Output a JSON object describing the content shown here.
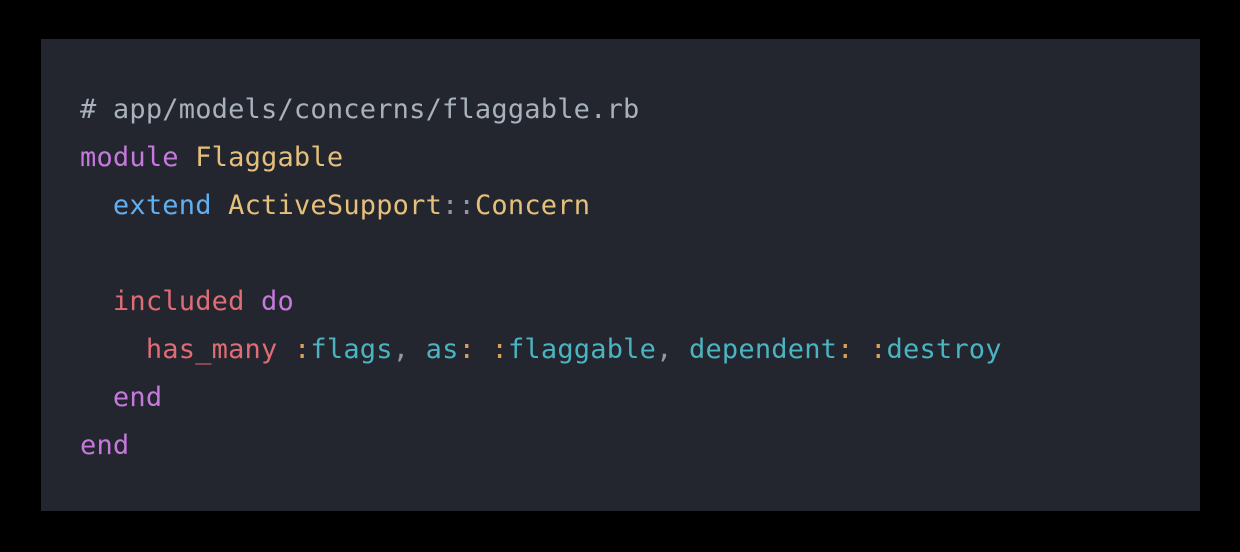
{
  "window": {
    "background_color": "#000000",
    "panel_background_color": "#23262f",
    "panel_label": "ruby-code-snippet-panel"
  },
  "theme": {
    "name": "dark",
    "comment_color": "#a9b1bd",
    "keyword_color": "#c678dd",
    "constant_color": "#e5c07b",
    "function_color": "#61afef",
    "method_color": "#e06c75",
    "symbol_color": "#4ab4c0",
    "punctuation_color": "#8f98a6",
    "colon_color": "#d9a05b",
    "plain_color": "#c5ccd6"
  },
  "code": {
    "language": "ruby",
    "file_comment": "# app/models/concerns/flaggable.rb",
    "full_text": "# app/models/concerns/flaggable.rb\nmodule Flaggable\n  extend ActiveSupport::Concern\n\n  included do\n    has_many :flags, as: :flaggable, dependent: :destroy\n  end\nend",
    "lines": [
      {
        "id": "line-1",
        "kind": "comment",
        "tokens": [
          {
            "text": "# app/models/concerns/flaggable.rb",
            "type": "comment"
          }
        ]
      },
      {
        "id": "line-2",
        "kind": "code",
        "tokens": [
          {
            "text": "module",
            "type": "keyword"
          },
          {
            "text": " ",
            "type": "plain"
          },
          {
            "text": "Flaggable",
            "type": "const"
          }
        ]
      },
      {
        "id": "line-3",
        "kind": "code",
        "tokens": [
          {
            "text": "  ",
            "type": "plain"
          },
          {
            "text": "extend",
            "type": "func"
          },
          {
            "text": " ",
            "type": "plain"
          },
          {
            "text": "ActiveSupport",
            "type": "const"
          },
          {
            "text": "::",
            "type": "punct"
          },
          {
            "text": "Concern",
            "type": "const"
          }
        ]
      },
      {
        "id": "line-4",
        "kind": "blank",
        "tokens": []
      },
      {
        "id": "line-5",
        "kind": "code",
        "tokens": [
          {
            "text": "  ",
            "type": "plain"
          },
          {
            "text": "included",
            "type": "method"
          },
          {
            "text": " ",
            "type": "plain"
          },
          {
            "text": "do",
            "type": "keyword"
          }
        ]
      },
      {
        "id": "line-6",
        "kind": "code",
        "tokens": [
          {
            "text": "    ",
            "type": "plain"
          },
          {
            "text": "has_many",
            "type": "method"
          },
          {
            "text": " ",
            "type": "plain"
          },
          {
            "text": ":",
            "type": "colon"
          },
          {
            "text": "flags",
            "type": "symbol"
          },
          {
            "text": ",",
            "type": "punct"
          },
          {
            "text": " ",
            "type": "plain"
          },
          {
            "text": "as",
            "type": "symbol"
          },
          {
            "text": ":",
            "type": "colon"
          },
          {
            "text": " ",
            "type": "plain"
          },
          {
            "text": ":",
            "type": "colon"
          },
          {
            "text": "flaggable",
            "type": "symbol"
          },
          {
            "text": ",",
            "type": "punct"
          },
          {
            "text": " ",
            "type": "plain"
          },
          {
            "text": "dependent",
            "type": "symbol"
          },
          {
            "text": ":",
            "type": "colon"
          },
          {
            "text": " ",
            "type": "plain"
          },
          {
            "text": ":",
            "type": "colon"
          },
          {
            "text": "destroy",
            "type": "symbol"
          }
        ]
      },
      {
        "id": "line-7",
        "kind": "code",
        "tokens": [
          {
            "text": "  ",
            "type": "plain"
          },
          {
            "text": "end",
            "type": "keyword"
          }
        ]
      },
      {
        "id": "line-8",
        "kind": "code",
        "tokens": [
          {
            "text": "end",
            "type": "keyword"
          }
        ]
      }
    ]
  }
}
